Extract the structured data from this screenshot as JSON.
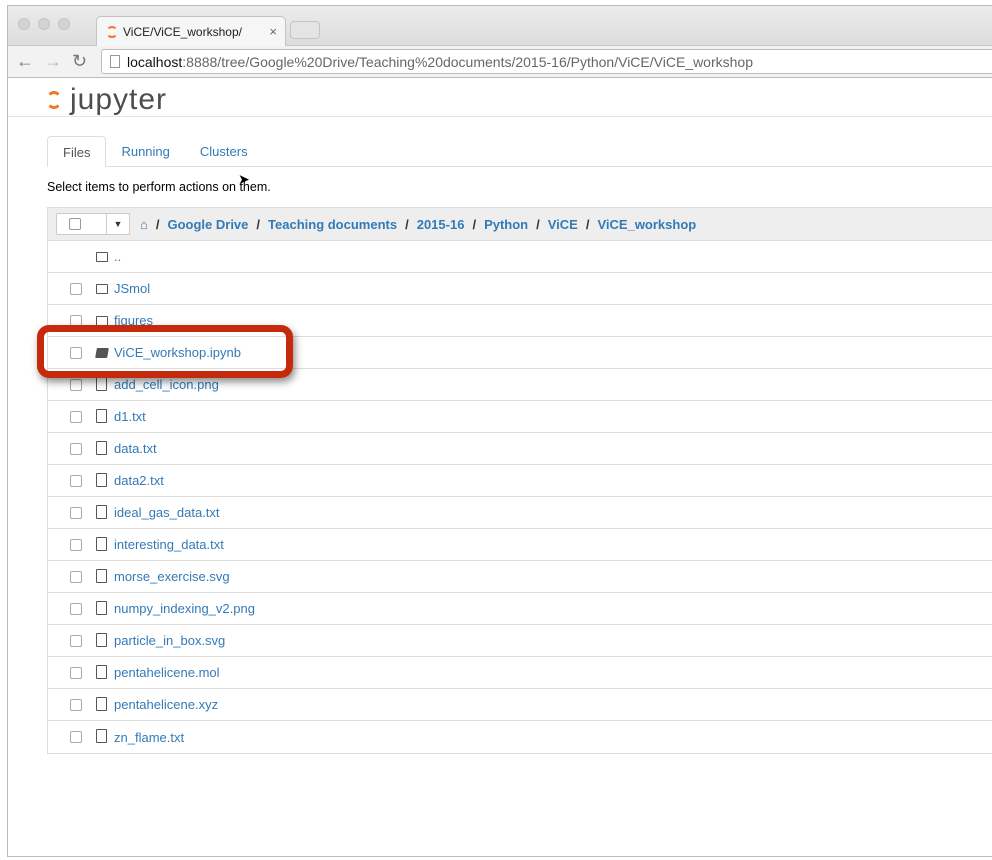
{
  "browser": {
    "tab_title": "ViCE/ViCE_workshop/",
    "url_host": "localhost",
    "url_rest": ":8888/tree/Google%20Drive/Teaching%20documents/2015-16/Python/ViCE/ViCE_workshop",
    "close": "×"
  },
  "logo": "jupyter",
  "tabs": [
    "Files",
    "Running",
    "Clusters"
  ],
  "hint": "Select items to perform actions on them.",
  "breadcrumb": [
    "Google Drive",
    "Teaching documents",
    "2015-16",
    "Python",
    "ViCE",
    "ViCE_workshop"
  ],
  "files": [
    {
      "name": "..",
      "type": "folder"
    },
    {
      "name": "JSmol",
      "type": "folder"
    },
    {
      "name": "figures",
      "type": "folder"
    },
    {
      "name": "ViCE_workshop.ipynb",
      "type": "notebook"
    },
    {
      "name": "add_cell_icon.png",
      "type": "file"
    },
    {
      "name": "d1.txt",
      "type": "file"
    },
    {
      "name": "data.txt",
      "type": "file"
    },
    {
      "name": "data2.txt",
      "type": "file"
    },
    {
      "name": "ideal_gas_data.txt",
      "type": "file"
    },
    {
      "name": "interesting_data.txt",
      "type": "file"
    },
    {
      "name": "morse_exercise.svg",
      "type": "file"
    },
    {
      "name": "numpy_indexing_v2.png",
      "type": "file"
    },
    {
      "name": "particle_in_box.svg",
      "type": "file"
    },
    {
      "name": "pentahelicene.mol",
      "type": "file"
    },
    {
      "name": "pentahelicene.xyz",
      "type": "file"
    },
    {
      "name": "zn_flame.txt",
      "type": "file"
    }
  ],
  "highlight_color": "#c42a0b"
}
